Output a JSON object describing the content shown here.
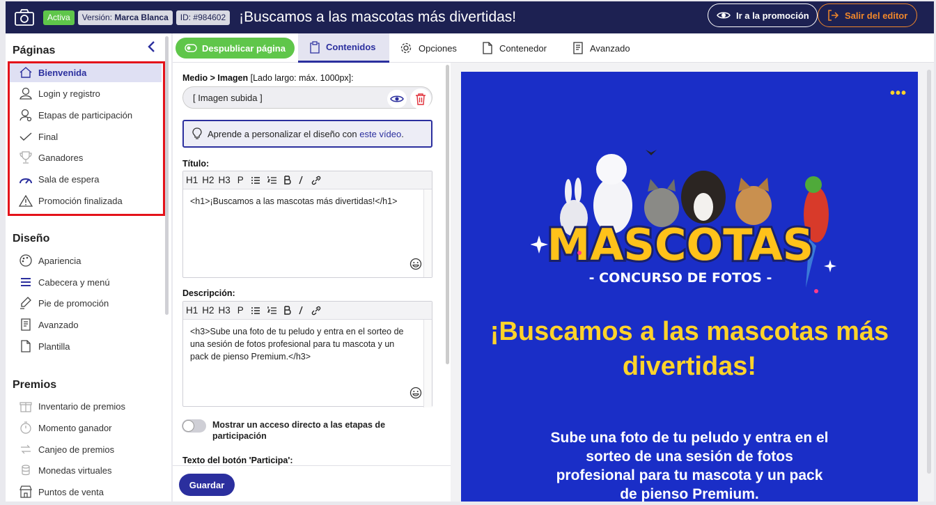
{
  "topbar": {
    "status_badge": "Activa",
    "version_label": "Versión:",
    "version_value": "Marca Blanca",
    "id_badge": "ID: #984602",
    "page_title": "¡Buscamos a las mascotas más divertidas!",
    "go_promo_label": "Ir a la promoción",
    "exit_label": "Salir del editor"
  },
  "sidebar": {
    "pages_title": "Páginas",
    "pages": [
      {
        "label": "Bienvenida",
        "icon": "home-icon",
        "active": true
      },
      {
        "label": "Login y registro",
        "icon": "user-icon"
      },
      {
        "label": "Etapas de participación",
        "icon": "user-settings-icon"
      },
      {
        "label": "Final",
        "icon": "check-icon"
      },
      {
        "label": "Ganadores",
        "icon": "trophy-icon"
      },
      {
        "label": "Sala de espera",
        "icon": "gauge-icon"
      },
      {
        "label": "Promoción finalizada",
        "icon": "warning-icon"
      }
    ],
    "design_title": "Diseño",
    "design": [
      {
        "label": "Apariencia",
        "icon": "palette-icon"
      },
      {
        "label": "Cabecera y menú",
        "icon": "menu-icon"
      },
      {
        "label": "Pie de promoción",
        "icon": "footer-icon"
      },
      {
        "label": "Avanzado",
        "icon": "code-file-icon"
      },
      {
        "label": "Plantilla",
        "icon": "template-icon"
      }
    ],
    "prizes_title": "Premios",
    "prizes": [
      {
        "label": "Inventario de premios",
        "icon": "gift-icon"
      },
      {
        "label": "Momento ganador",
        "icon": "timer-icon"
      },
      {
        "label": "Canjeo de premios",
        "icon": "exchange-icon"
      },
      {
        "label": "Monedas virtuales",
        "icon": "coins-icon"
      },
      {
        "label": "Puntos de venta",
        "icon": "store-icon"
      }
    ]
  },
  "tabs": {
    "unpublish_label": "Despublicar página",
    "items": [
      {
        "label": "Contenidos",
        "icon": "clipboard-icon",
        "active": true
      },
      {
        "label": "Opciones",
        "icon": "gear-icon"
      },
      {
        "label": "Contenedor",
        "icon": "file-icon"
      },
      {
        "label": "Avanzado",
        "icon": "code-file-icon"
      }
    ]
  },
  "editor": {
    "media_label": "Medio > Imagen",
    "media_hint": "[Lado largo: máx. 1000px]:",
    "media_value": "[ Imagen subida ]",
    "tip_text": "Aprende a personalizar el diseño con ",
    "tip_link": "este vídeo",
    "tip_end": ".",
    "title_label": "Título:",
    "title_value": "<h1>¡Buscamos a las mascotas más divertidas!</h1>",
    "desc_label": "Descripción:",
    "desc_value": "<h3>Sube una foto de tu peludo y entra en el sorteo de una sesión de fotos profesional para tu mascota y un pack de pienso Premium.</h3>",
    "toolbar_buttons": [
      "H1",
      "H2",
      "H3",
      "P"
    ],
    "toggle_label": "Mostrar un acceso directo a las etapas de participación",
    "toggle_on": false,
    "cta_label": "Texto del botón 'Participa':",
    "save_label": "Guardar"
  },
  "preview": {
    "logo_word": "MASCOTAS",
    "logo_sub": "- CONCURSO DE FOTOS -",
    "heading": "¡Buscamos a las mascotas más divertidas!",
    "subheading": "Sube una foto de tu peludo y entra en el sorteo de una sesión de fotos profesional para tu mascota y un pack de pienso Premium.",
    "more_icon": "•••"
  },
  "colors": {
    "navy": "#1d2152",
    "accent": "#2b2f9e",
    "green": "#5fc64a",
    "orange": "#f0872a",
    "preview_bg": "#1a2ec7",
    "yellow": "#ffd32a",
    "highlight_red": "#e4121a"
  }
}
